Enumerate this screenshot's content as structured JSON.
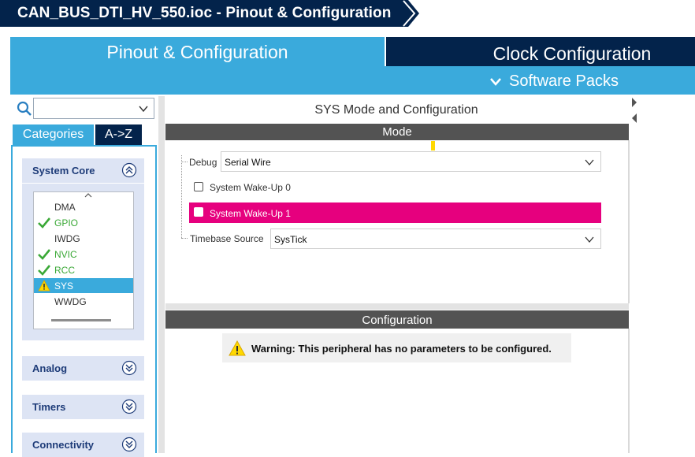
{
  "window": {
    "title": "CAN_BUS_DTI_HV_550.ioc - Pinout & Configuration"
  },
  "main_tabs": [
    {
      "label": "Pinout & Configuration",
      "active": true
    },
    {
      "label": "Clock Configuration",
      "active": false
    }
  ],
  "software_packs": {
    "label": "Software Packs",
    "icon": "chevron-down-icon"
  },
  "search": {
    "value": "",
    "placeholder": ""
  },
  "category_tabs": [
    {
      "label": "Categories",
      "active": true
    },
    {
      "label": "A->Z",
      "active": false
    }
  ],
  "groups": [
    {
      "label": "System Core",
      "expanded": true,
      "icon": "chevron-double-up-icon"
    },
    {
      "label": "Analog",
      "expanded": false,
      "icon": "chevron-double-down-icon"
    },
    {
      "label": "Timers",
      "expanded": false,
      "icon": "chevron-double-down-icon"
    },
    {
      "label": "Connectivity",
      "expanded": false,
      "icon": "chevron-double-down-icon"
    }
  ],
  "system_core_items": [
    {
      "label": "DMA",
      "status": "none"
    },
    {
      "label": "GPIO",
      "status": "ok"
    },
    {
      "label": "IWDG",
      "status": "none"
    },
    {
      "label": "NVIC",
      "status": "ok"
    },
    {
      "label": "RCC",
      "status": "ok"
    },
    {
      "label": "SYS",
      "status": "warning",
      "selected": true
    },
    {
      "label": "WWDG",
      "status": "none"
    }
  ],
  "mode_panel": {
    "title": "SYS Mode and Configuration",
    "header": "Mode",
    "debug": {
      "label": "Debug",
      "value": "Serial Wire"
    },
    "wakeup0": {
      "label": "System Wake-Up 0",
      "checked": false
    },
    "wakeup1": {
      "label": "System Wake-Up 1",
      "checked": false,
      "highlight": "#e6007e"
    },
    "timebase": {
      "label": "Timebase Source",
      "value": "SysTick"
    }
  },
  "config_panel": {
    "header": "Configuration",
    "warning": "Warning: This peripheral has no parameters to be configured."
  },
  "colors": {
    "navy": "#03234b",
    "accent_blue": "#3aaadc",
    "ok_green": "#3aa836",
    "highlight_magenta": "#e6007e",
    "section_header": "#535353",
    "warning_yellow": "#ffd800"
  }
}
